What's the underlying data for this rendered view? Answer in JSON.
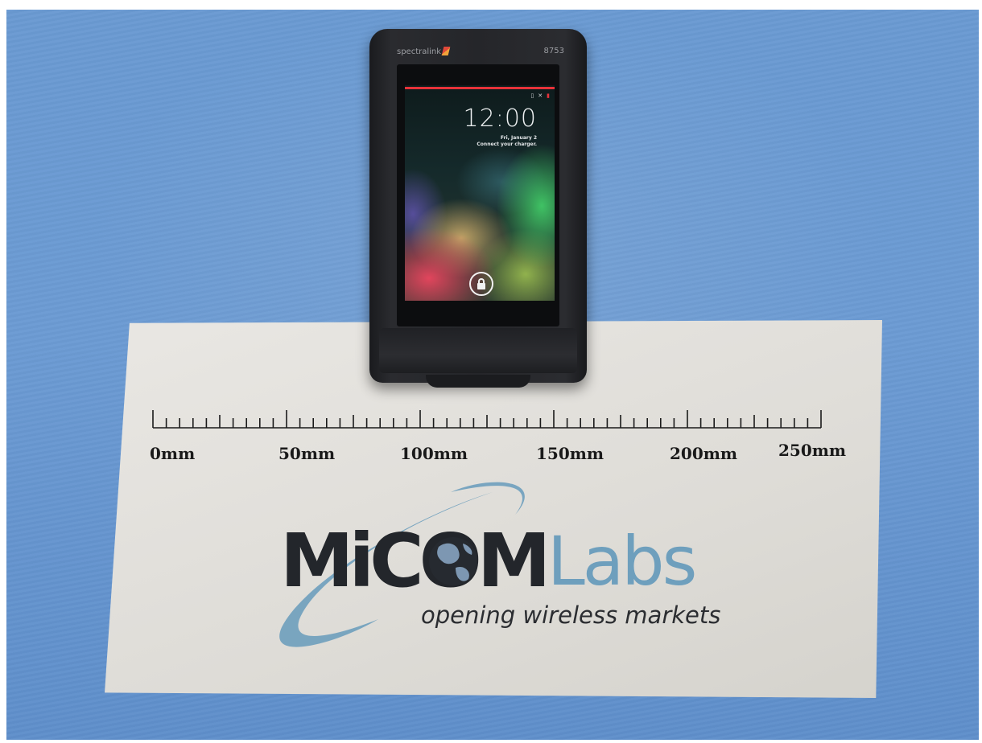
{
  "scene": {
    "colors": {
      "cloth": "#6a9ad2",
      "paper": "#e2e0dc",
      "phone_body": "#25262a",
      "logo_dark": "#23262b",
      "logo_blue": "#6e9fbd",
      "lock_accent": "#e8323a"
    }
  },
  "phone": {
    "brand": "spectralink",
    "model": "8753",
    "lockscreen": {
      "time": "12:00",
      "date": "Fri, January 2",
      "status_message": "Connect your charger.",
      "lock_icon": "lock-icon"
    }
  },
  "ruler": {
    "labels": [
      "0mm",
      "50mm",
      "100mm",
      "150mm",
      "200mm",
      "250mm"
    ]
  },
  "logo": {
    "name_dark": "MiCOM",
    "name_light": "Labs",
    "tagline": "opening wireless markets",
    "globe_icon": "globe-icon"
  }
}
